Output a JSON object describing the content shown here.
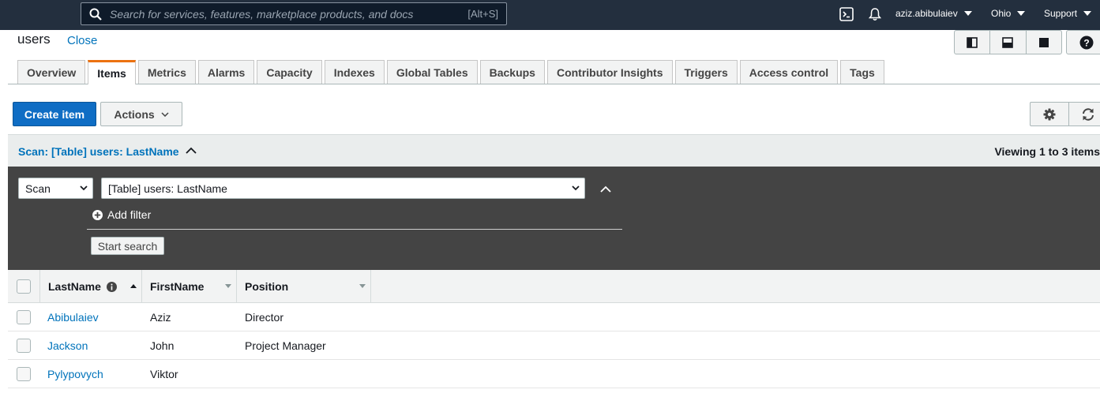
{
  "topnav": {
    "search_placeholder": "Search for services, features, marketplace products, and docs",
    "search_shortcut": "[Alt+S]",
    "user": "aziz.abibulaiev",
    "region": "Ohio",
    "support": "Support"
  },
  "header": {
    "title": "users",
    "close": "Close"
  },
  "tabs": [
    {
      "label": "Overview"
    },
    {
      "label": "Items"
    },
    {
      "label": "Metrics"
    },
    {
      "label": "Alarms"
    },
    {
      "label": "Capacity"
    },
    {
      "label": "Indexes"
    },
    {
      "label": "Global Tables"
    },
    {
      "label": "Backups"
    },
    {
      "label": "Contributor Insights"
    },
    {
      "label": "Triggers"
    },
    {
      "label": "Access control"
    },
    {
      "label": "Tags"
    }
  ],
  "active_tab": "Items",
  "toolbar": {
    "create_item": "Create item",
    "actions": "Actions"
  },
  "scan": {
    "title": "Scan: [Table] users: LastName",
    "viewing": "Viewing 1 to 3 items",
    "mode": "Scan",
    "source": "[Table] users: LastName",
    "add_filter": "Add filter",
    "start_search": "Start search"
  },
  "table": {
    "columns": [
      "LastName",
      "FirstName",
      "Position"
    ],
    "rows": [
      {
        "LastName": "Abibulaiev",
        "FirstName": "Aziz",
        "Position": "Director"
      },
      {
        "LastName": "Jackson",
        "FirstName": "John",
        "Position": "Project Manager"
      },
      {
        "LastName": "Pylypovych",
        "FirstName": "Viktor",
        "Position": ""
      }
    ]
  },
  "colors": {
    "nav_bg": "#232f3e",
    "primary": "#0f6dc4",
    "link": "#0073bb",
    "tab_accent": "#ec7211",
    "panel_bg": "#444444"
  }
}
